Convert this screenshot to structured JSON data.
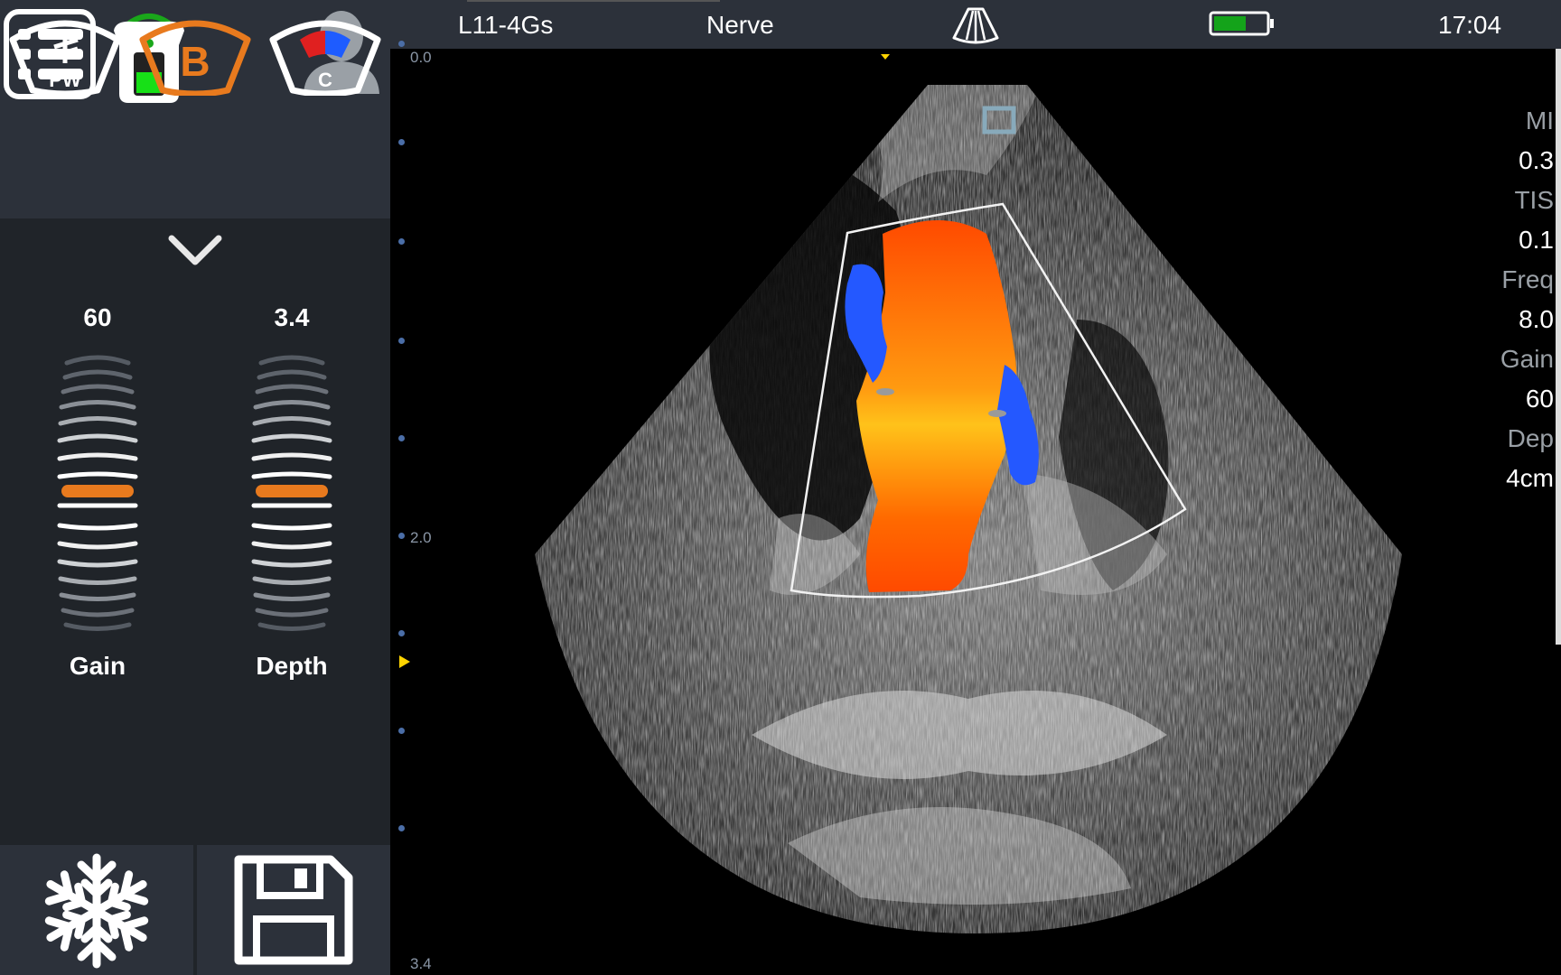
{
  "status_bar": {
    "probe": "L11-4Gs",
    "preset": "Nerve",
    "time": "17:04",
    "battery_level": 0.62,
    "icons": [
      "sector-probe-icon",
      "battery-icon"
    ]
  },
  "left_panel": {
    "icons": [
      "menu-list-icon",
      "wireless-probe-icon",
      "user-icon"
    ],
    "modes": [
      {
        "id": "pw",
        "label": "PW",
        "active": false
      },
      {
        "id": "b",
        "label": "B",
        "active": true
      },
      {
        "id": "c",
        "label": "C",
        "active": false
      }
    ],
    "gain": {
      "value": "60",
      "label": "Gain"
    },
    "depth": {
      "value": "3.4",
      "label": "Depth"
    },
    "bottom_buttons": [
      "freeze-snowflake-icon",
      "save-floppy-icon"
    ]
  },
  "image": {
    "depth_scale": {
      "top": "0.0",
      "mid": "2.0",
      "bottom": "3.4"
    },
    "params": [
      {
        "key": "MI",
        "value": "0.3"
      },
      {
        "key": "TIS",
        "value": "0.1"
      },
      {
        "key": "Freq",
        "value": "8.0"
      },
      {
        "key": "Gain",
        "value": "60"
      },
      {
        "key": "Dep",
        "value": "4cm"
      }
    ]
  },
  "colors": {
    "panel": "#2c313a",
    "panel_dark": "#202429",
    "accent": "#e87a1e",
    "doppler_red": "#ff5a00",
    "doppler_blue": "#2255ff"
  }
}
